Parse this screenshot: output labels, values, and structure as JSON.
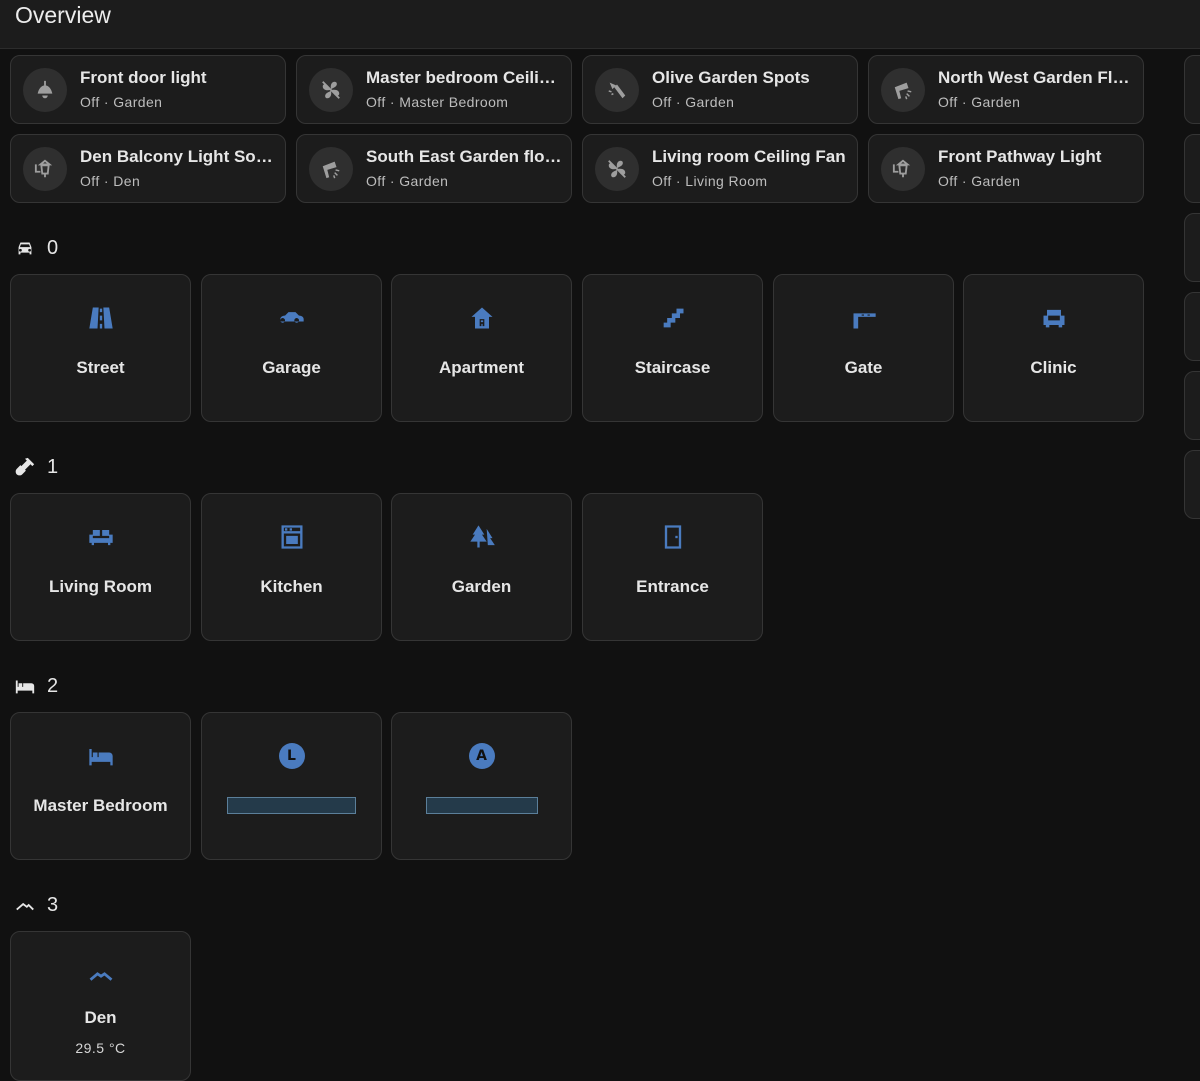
{
  "header": {
    "title": "Overview"
  },
  "tiles": [
    {
      "name": "Front door light",
      "state": "Off · Garden",
      "icon": "ceiling-light-icon"
    },
    {
      "name": "Master bedroom Ceilin...",
      "state": "Off · Master Bedroom",
      "icon": "fan-off-icon"
    },
    {
      "name": "Olive Garden Spots",
      "state": "Off · Garden",
      "icon": "spotlight-icon"
    },
    {
      "name": "North West Garden Flo...",
      "state": "Off · Garden",
      "icon": "floodlight-icon"
    },
    {
      "name": "Den Balcony Light Sou...",
      "state": "Off · Den",
      "icon": "outdoor-lamp-icon"
    },
    {
      "name": "South East Garden floo...",
      "state": "Off · Garden",
      "icon": "floodlight-icon"
    },
    {
      "name": "Living room Ceiling Fan",
      "state": "Off · Living Room",
      "icon": "fan-off-icon"
    },
    {
      "name": "Front Pathway Light",
      "state": "Off · Garden",
      "icon": "outdoor-lamp-icon"
    }
  ],
  "sections": [
    {
      "label": "0",
      "icon": "car-icon",
      "areas": [
        {
          "name": "Street",
          "icon": "road-icon"
        },
        {
          "name": "Garage",
          "icon": "car-side-icon"
        },
        {
          "name": "Apartment",
          "icon": "home-letter-icon"
        },
        {
          "name": "Staircase",
          "icon": "stairs-icon"
        },
        {
          "name": "Gate",
          "icon": "boom-gate-icon"
        },
        {
          "name": "Clinic",
          "icon": "armchair-icon"
        }
      ]
    },
    {
      "label": "1",
      "icon": "shovel-icon",
      "areas": [
        {
          "name": "Living Room",
          "icon": "sofa-icon"
        },
        {
          "name": "Kitchen",
          "icon": "stove-icon"
        },
        {
          "name": "Garden",
          "icon": "pine-trees-icon"
        },
        {
          "name": "Entrance",
          "icon": "door-icon"
        }
      ]
    },
    {
      "label": "2",
      "icon": "bed-icon",
      "areas": [
        {
          "name": "Master Bedroom",
          "icon": "bed-icon"
        },
        {
          "name": "",
          "icon": "letter-badge-icon",
          "badge": "L"
        },
        {
          "name": "",
          "icon": "letter-badge-icon",
          "badge": "A"
        }
      ]
    },
    {
      "label": "3",
      "icon": "roof-icon",
      "areas": [
        {
          "name": "Den",
          "icon": "roof-icon",
          "sub": "29.5 °C"
        }
      ]
    }
  ],
  "colors": {
    "accent": "#4a7bbf",
    "icon_grey": "#9e9e9e",
    "card_bg": "#1c1c1c",
    "page_bg": "#111111"
  }
}
